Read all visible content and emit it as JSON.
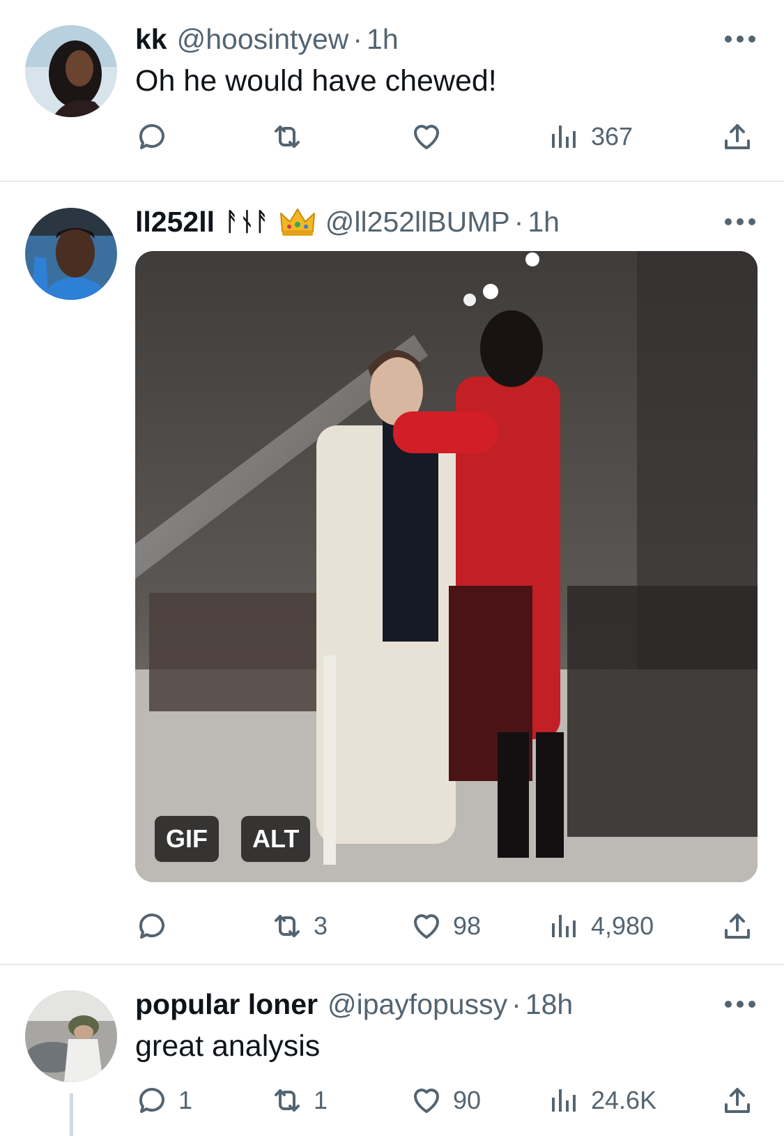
{
  "tweets": [
    {
      "display_name": "kk",
      "handle": "@hoosintyew",
      "separator": "·",
      "time": "1h",
      "text": "Oh he would have chewed!",
      "replies": "",
      "retweets": "",
      "likes": "",
      "views": "367"
    },
    {
      "display_name": "ll252ll",
      "display_name_runes": "ᚨᚾᚨ",
      "handle": "@ll252llBUMP",
      "separator": "·",
      "time": "1h",
      "text": "",
      "media_badges": {
        "gif": "GIF",
        "alt": "ALT"
      },
      "replies": "",
      "retweets": "3",
      "likes": "98",
      "views": "4,980"
    },
    {
      "display_name": "popular loner",
      "handle": "@ipayfopussy",
      "separator": "·",
      "time": "18h",
      "text": "great analysis",
      "replies": "1",
      "retweets": "1",
      "likes": "90",
      "views": "24.6K"
    }
  ],
  "icons": {
    "reply": "reply-icon",
    "retweet": "retweet-icon",
    "like": "heart-icon",
    "views": "views-icon",
    "share": "share-icon",
    "more": "more-icon",
    "crown": "crown-emoji"
  },
  "colors": {
    "text_primary": "#0f1419",
    "text_secondary": "#536471",
    "divider": "#e6e9ec"
  }
}
